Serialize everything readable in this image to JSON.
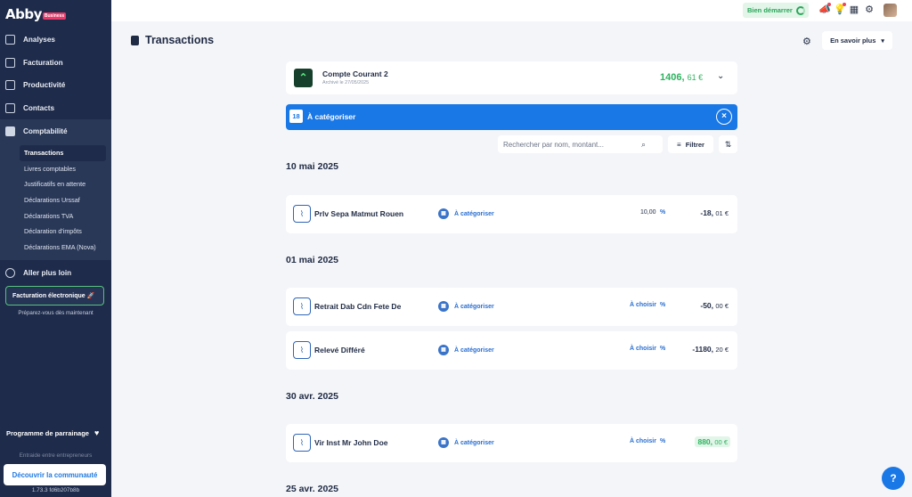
{
  "brand": {
    "name": "Abby",
    "badge": "Business"
  },
  "sidebar": {
    "items": [
      {
        "label": "Analyses",
        "icon": "chart-icon"
      },
      {
        "label": "Facturation",
        "icon": "invoice-icon"
      },
      {
        "label": "Productivité",
        "icon": "grid-icon"
      },
      {
        "label": "Contacts",
        "icon": "contacts-icon"
      },
      {
        "label": "Comptabilité",
        "icon": "calculator-icon"
      }
    ],
    "sub_items": [
      "Transactions",
      "Livres comptables",
      "Justificatifs en attente",
      "Déclarations Urssaf",
      "Déclarations TVA",
      "Déclaration d'impôts",
      "Déclarations EMA (Nova)"
    ],
    "go_further": "Aller plus loin",
    "einvoice_label": "Facturation électronique 🚀",
    "einvoice_sub": "Préparez-vous dès maintenant",
    "referral": "Programme de parrainage",
    "community_sub": "Entraide entre entrepreneurs",
    "community_btn": "Découvrir la communauté",
    "version": "1.73.3 fd6b207b8b"
  },
  "topbar": {
    "start_label": "Bien démarrer"
  },
  "page": {
    "title": "Transactions",
    "learn_more": "En savoir plus"
  },
  "account": {
    "name": "Compte Courant 2",
    "subtitle": "Archivé le 27/05/2025",
    "balance_int": "1406,",
    "balance_dec": "61 €"
  },
  "categorize_bar": {
    "count": "18",
    "label": "À catégoriser"
  },
  "search": {
    "placeholder": "Rechercher par nom, montant..."
  },
  "filter_label": "Filtrer",
  "groups": [
    {
      "date": "10 mai 2025"
    },
    {
      "date": "01 mai 2025"
    },
    {
      "date": "30 avr. 2025"
    },
    {
      "date": "25 avr. 2025"
    }
  ],
  "transactions": [
    {
      "label": "Prlv Sepa Matmut Rouen",
      "category": "À catégoriser",
      "vat": "10,00",
      "pct": "%",
      "amount_int": "-18,",
      "amount_dec": "01 €"
    },
    {
      "label": "Retrait Dab Cdn Fete De",
      "category": "À catégoriser",
      "vat": "À choisir",
      "pct": "%",
      "amount_int": "-50,",
      "amount_dec": "00 €"
    },
    {
      "label": "Relevé Différé",
      "category": "À catégoriser",
      "vat": "À choisir",
      "pct": "%",
      "amount_int": "-1180,",
      "amount_dec": "20 €"
    },
    {
      "label": "Vir Inst Mr John Doe",
      "category": "À catégoriser",
      "vat": "À choisir",
      "pct": "%",
      "amount_int": "880,",
      "amount_dec": "00 €"
    }
  ],
  "help_label": "?",
  "colors": {
    "sidebar": "#1e2b4a",
    "accent": "#1a78e6",
    "positive": "#2eb35f"
  }
}
